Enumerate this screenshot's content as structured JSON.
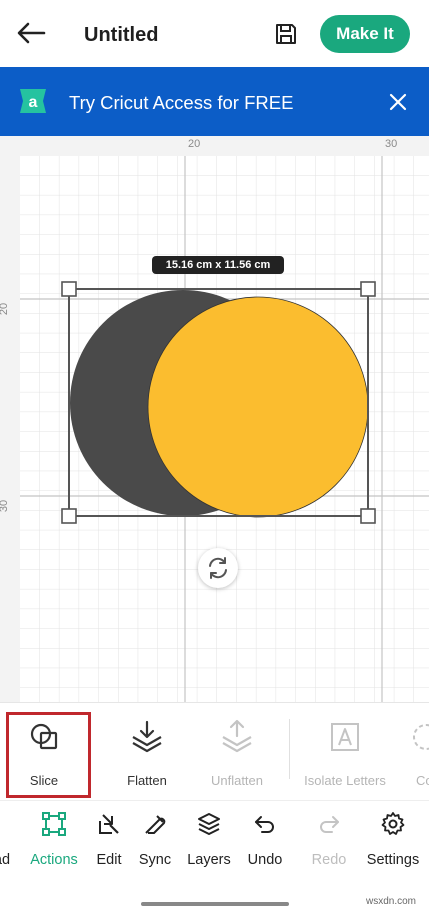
{
  "header": {
    "title": "Untitled",
    "make_it_label": "Make It",
    "accent": "#1aa87e"
  },
  "banner": {
    "text": "Try Cricut Access for FREE",
    "background": "#0c5dc7"
  },
  "canvas": {
    "ruler_top": [
      "20",
      "30"
    ],
    "ruler_left": [
      "20",
      "30"
    ],
    "dimensions": "15.16 cm x 11.56 cm",
    "shapes": [
      {
        "name": "dark-circle",
        "color": "#4a4a4a"
      },
      {
        "name": "yellow-circle",
        "color": "#fbbd2f"
      }
    ]
  },
  "actions": {
    "items": [
      {
        "label": "Slice",
        "icon": "slice-icon",
        "enabled": true,
        "highlighted": true
      },
      {
        "label": "Flatten",
        "icon": "flatten-icon",
        "enabled": true
      },
      {
        "label": "Unflatten",
        "icon": "unflatten-icon",
        "enabled": false
      },
      {
        "label": "Isolate Letters",
        "icon": "isolate-letters-icon",
        "enabled": false
      },
      {
        "label": "Co",
        "icon": "contour-icon",
        "enabled": false
      }
    ]
  },
  "nav": {
    "items": [
      {
        "label": "ad",
        "icon": "upload-icon"
      },
      {
        "label": "Actions",
        "icon": "actions-icon",
        "active": true
      },
      {
        "label": "Edit",
        "icon": "edit-icon"
      },
      {
        "label": "Sync",
        "icon": "sync-icon"
      },
      {
        "label": "Layers",
        "icon": "layers-icon"
      },
      {
        "label": "Undo",
        "icon": "undo-icon"
      },
      {
        "label": "Redo",
        "icon": "redo-icon",
        "enabled": false
      },
      {
        "label": "Settings",
        "icon": "gear-icon"
      }
    ]
  },
  "watermark": "wsxdn.com"
}
